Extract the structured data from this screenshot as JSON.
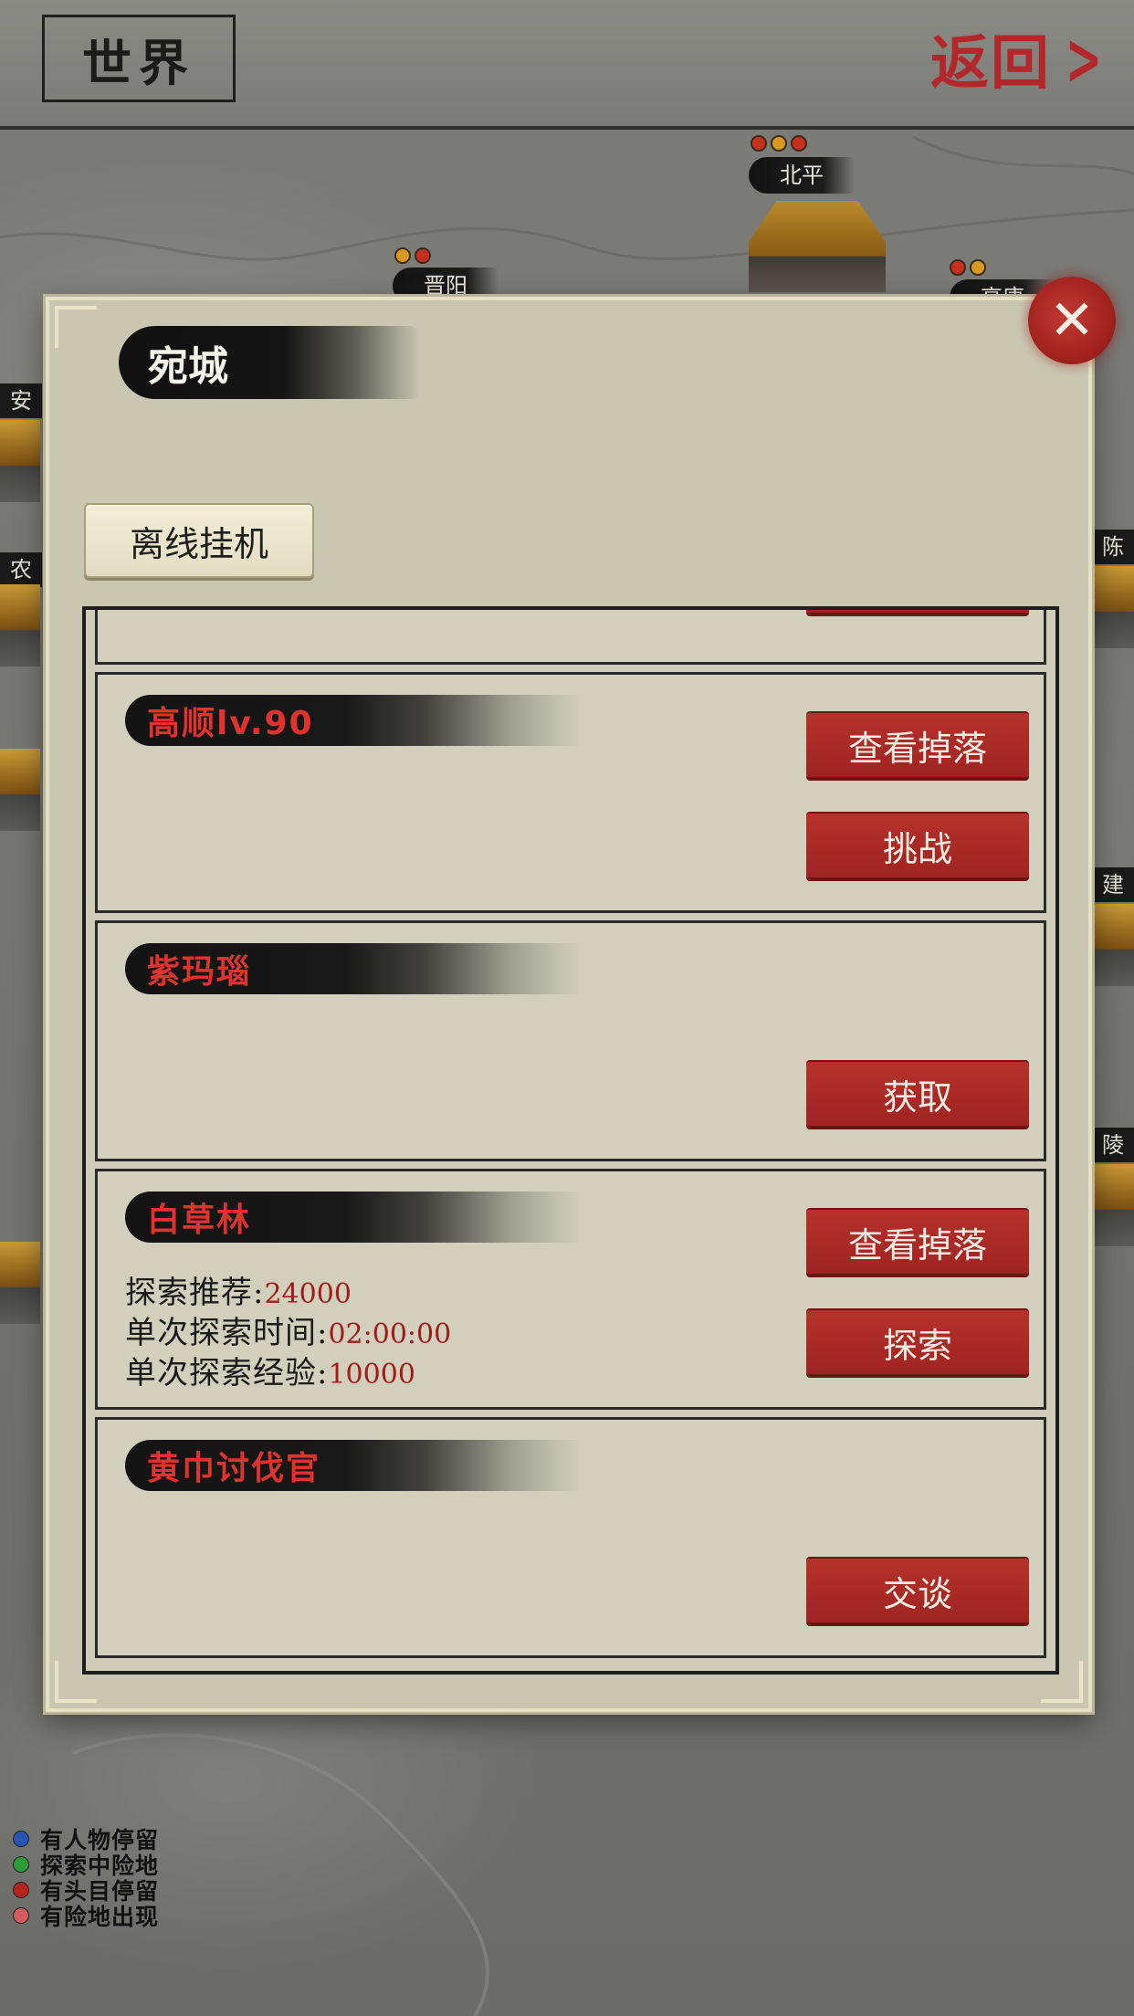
{
  "header": {
    "title": "世界",
    "back_label": "返回",
    "back_chevron": ">"
  },
  "map": {
    "cities": [
      {
        "name": "北平",
        "dots": [
          "#c6301c",
          "#d79a1f",
          "#c6301c"
        ]
      },
      {
        "name": "晋阳",
        "dots": [
          "#d79a1f",
          "#c6301c"
        ]
      },
      {
        "name": "高唐",
        "dots": [
          "#c6301c",
          "#d79a1f"
        ]
      }
    ],
    "side_labels": [
      "安",
      "农",
      "陈留",
      "建",
      "陵"
    ]
  },
  "legend": [
    {
      "color": "#2855b4",
      "label": "有人物停留"
    },
    {
      "color": "#2f9a38",
      "label": "探索中险地"
    },
    {
      "color": "#b8221c",
      "label": "有头目停留"
    },
    {
      "color": "#d35b5d",
      "label": "有险地出现"
    }
  ],
  "dialog": {
    "city_name": "宛城",
    "close_icon": "✕",
    "idle_button": "离线挂机",
    "cards": [
      {
        "title": "高顺lv.90",
        "buttons": [
          "查看掉落",
          "挑战"
        ]
      },
      {
        "title": "紫玛瑙",
        "buttons": [
          "获取"
        ]
      },
      {
        "title": "白草林",
        "buttons": [
          "查看掉落",
          "探索"
        ],
        "info": [
          {
            "label": "探索推荐:",
            "value": "24000"
          },
          {
            "label": "单次探索时间:",
            "value": "02:00:00"
          },
          {
            "label": "单次探索经验:",
            "value": "10000"
          }
        ]
      },
      {
        "title": "黄巾讨伐官",
        "buttons": [
          "交谈"
        ]
      }
    ]
  },
  "colors": {
    "accent_red": "#a8281f",
    "panel_bg": "#c9c7b2",
    "value_red": "#a11d1d"
  }
}
